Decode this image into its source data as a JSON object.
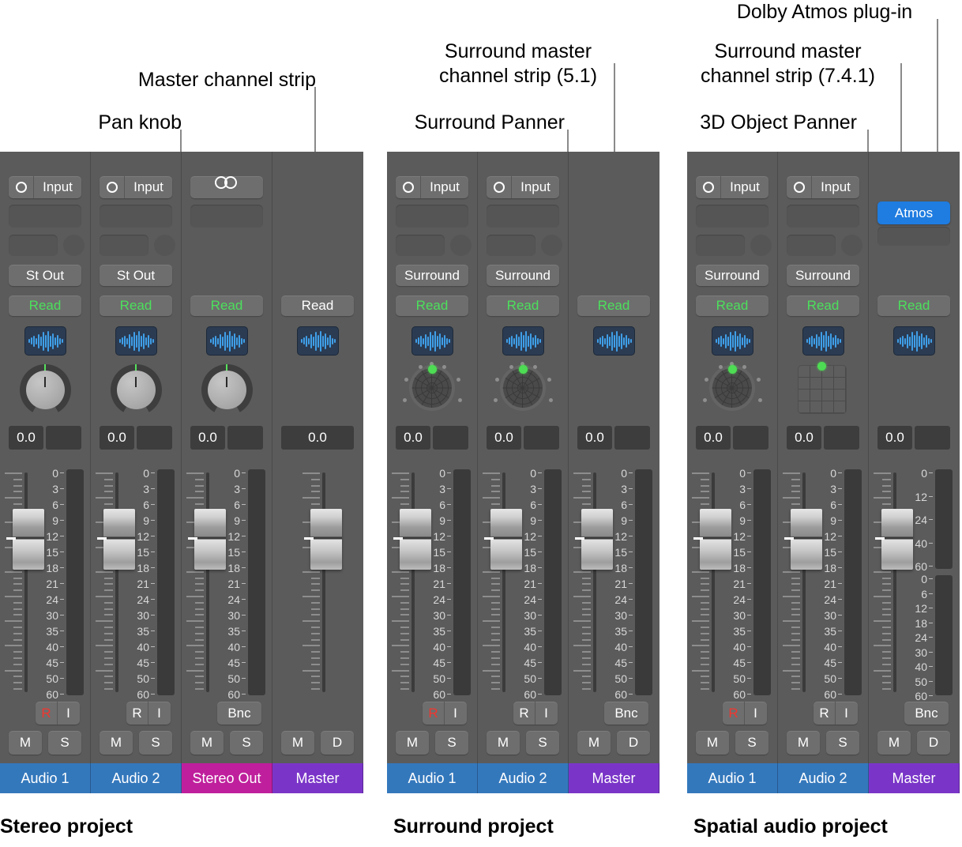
{
  "callouts": [
    {
      "id": "pan-knob",
      "text": "Pan knob"
    },
    {
      "id": "master-channel-strip",
      "text": "Master channel strip"
    },
    {
      "id": "surround-panner",
      "text": "Surround Panner"
    },
    {
      "id": "surround-master-51",
      "text": "Surround master\nchannel strip (5.1)"
    },
    {
      "id": "object-panner",
      "text": "3D Object Panner"
    },
    {
      "id": "surround-master-741",
      "text": "Surround master\nchannel strip (7.4.1)"
    },
    {
      "id": "dolby-atmos-plugin",
      "text": "Dolby Atmos plug-in"
    }
  ],
  "captions": {
    "stereo": "Stereo project",
    "surround": "Surround project",
    "spatial": "Spatial audio project"
  },
  "labels": {
    "input": "Input",
    "st_out": "St Out",
    "surround_out": "Surround",
    "read": "Read",
    "atmos": "Atmos",
    "value": "0.0",
    "rec": "R",
    "input_monitor": "I",
    "bounce": "Bnc",
    "mute": "M",
    "solo": "S",
    "dim": "D"
  },
  "meter_scale": [
    "0",
    "3",
    "6",
    "9",
    "12",
    "15",
    "18",
    "21",
    "24",
    "30",
    "35",
    "40",
    "45",
    "50",
    "60"
  ],
  "atmos_meter_top": [
    "0",
    "12",
    "24",
    "40",
    "60"
  ],
  "atmos_meter_bottom": [
    "0",
    "6",
    "12",
    "18",
    "24",
    "30",
    "40",
    "50",
    "60"
  ],
  "colors": {
    "audio_track": "#3478bc",
    "stereo_out": "#bf1f9c",
    "master": "#7a35c8",
    "atmos_blue": "#1f7ce0",
    "read_green": "#4ce05c",
    "rec_red": "#f2362f",
    "panel_bg": "#5b5b5b"
  },
  "projects": [
    {
      "id": "stereo",
      "strips": [
        {
          "name": "Audio 1",
          "plate_color": "#3478bc",
          "io": "input",
          "output": "St Out",
          "read_color": "green",
          "panner": "knob",
          "meter": "standard",
          "buttons": "ri",
          "rec_active": true,
          "ms": [
            "M",
            "S"
          ]
        },
        {
          "name": "Audio 2",
          "plate_color": "#3478bc",
          "io": "input",
          "output": "St Out",
          "read_color": "green",
          "panner": "knob",
          "meter": "standard",
          "buttons": "ri",
          "rec_active": false,
          "ms": [
            "M",
            "S"
          ]
        },
        {
          "name": "Stereo Out",
          "plate_color": "#bf1f9c",
          "io": "stereo",
          "output": "",
          "read_color": "green",
          "panner": "knob",
          "meter": "standard",
          "buttons": "bnc",
          "ms": [
            "M",
            "S"
          ]
        },
        {
          "name": "Master",
          "plate_color": "#7a35c8",
          "io": "none",
          "output": "",
          "read_color": "white",
          "panner": "none",
          "meter": "none",
          "buttons": "none",
          "ms": [
            "M",
            "D"
          ]
        }
      ]
    },
    {
      "id": "surround",
      "strips": [
        {
          "name": "Audio 1",
          "plate_color": "#3478bc",
          "io": "input",
          "output": "Surround",
          "read_color": "green",
          "panner": "surround",
          "meter": "standard",
          "buttons": "ri",
          "rec_active": true,
          "ms": [
            "M",
            "S"
          ]
        },
        {
          "name": "Audio 2",
          "plate_color": "#3478bc",
          "io": "input",
          "output": "Surround",
          "read_color": "green",
          "panner": "surround",
          "meter": "standard",
          "buttons": "ri",
          "rec_active": false,
          "ms": [
            "M",
            "S"
          ]
        },
        {
          "name": "Master",
          "plate_color": "#7a35c8",
          "io": "none",
          "output": "",
          "read_color": "green",
          "panner": "none",
          "meter": "standard",
          "buttons": "bnc",
          "ms": [
            "M",
            "D"
          ]
        }
      ]
    },
    {
      "id": "spatial",
      "strips": [
        {
          "name": "Audio 1",
          "plate_color": "#3478bc",
          "io": "input",
          "output": "Surround",
          "read_color": "green",
          "panner": "surround",
          "meter": "standard",
          "buttons": "ri",
          "rec_active": true,
          "ms": [
            "M",
            "S"
          ]
        },
        {
          "name": "Audio 2",
          "plate_color": "#3478bc",
          "io": "input",
          "output": "Surround",
          "read_color": "green",
          "panner": "object",
          "meter": "standard",
          "buttons": "ri",
          "rec_active": false,
          "ms": [
            "M",
            "S"
          ]
        },
        {
          "name": "Master",
          "plate_color": "#7a35c8",
          "io": "atmos",
          "output": "",
          "read_color": "green",
          "panner": "none",
          "meter": "atmos",
          "buttons": "bnc",
          "ms": [
            "M",
            "D"
          ]
        }
      ]
    }
  ]
}
